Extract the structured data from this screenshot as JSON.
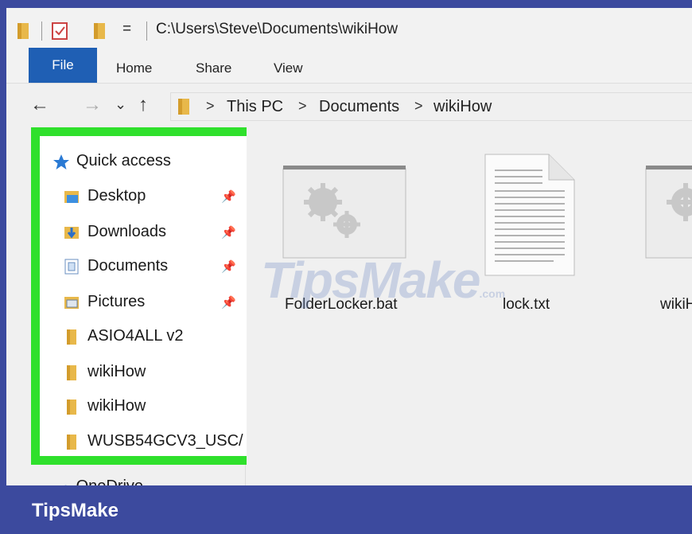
{
  "titlebar": {
    "path": "C:\\Users\\Steve\\Documents\\wikiHow",
    "dropdown_glyph": "="
  },
  "ribbon": {
    "tabs": [
      "File",
      "Home",
      "Share",
      "View"
    ]
  },
  "navigation": {
    "back": "←",
    "forward": "→",
    "recent": "⌄",
    "up": "↑",
    "breadcrumb": [
      "This PC",
      "Documents",
      "wikiHow"
    ],
    "separator": ">"
  },
  "sidebar": {
    "quick_access": "Quick access",
    "items": [
      {
        "label": "Desktop",
        "icon": "desktop-folder-icon",
        "pinned": true
      },
      {
        "label": "Downloads",
        "icon": "downloads-folder-icon",
        "pinned": true
      },
      {
        "label": "Documents",
        "icon": "documents-folder-icon",
        "pinned": true
      },
      {
        "label": "Pictures",
        "icon": "pictures-folder-icon",
        "pinned": true
      },
      {
        "label": "ASIO4ALL v2",
        "icon": "folder-icon",
        "pinned": false
      },
      {
        "label": "wikiHow",
        "icon": "folder-icon",
        "pinned": false
      },
      {
        "label": "wikiHow",
        "icon": "folder-icon",
        "pinned": false
      },
      {
        "label": "WUSB54GCV3_USC/",
        "icon": "folder-icon",
        "pinned": false
      }
    ],
    "onedrive": "OneDrive"
  },
  "files": [
    {
      "name": "FolderLocker.bat",
      "icon": "batch-file-icon"
    },
    {
      "name": "lock.txt",
      "icon": "text-file-icon"
    },
    {
      "name": "wikiH",
      "icon": "batch-file-icon"
    }
  ],
  "watermark": {
    "text": "TipsMake",
    "suffix": ".com"
  },
  "footer": {
    "brand": "TipsMake"
  },
  "colors": {
    "highlight": "#2fe02c",
    "file_tab": "#1f5fb4",
    "footer": "#3c4a9e"
  }
}
